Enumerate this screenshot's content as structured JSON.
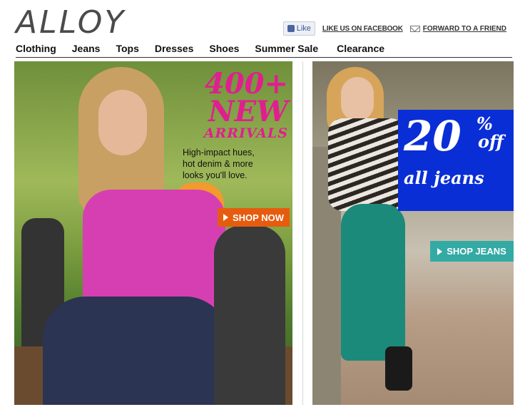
{
  "header": {
    "logo": "ALLOY",
    "social": {
      "like_label": "Like",
      "facebook_label": "LIKE US ON FACEBOOK",
      "forward_label": "FORWARD TO A FRIEND"
    }
  },
  "nav": {
    "items": [
      "Clothing",
      "Jeans",
      "Tops",
      "Dresses",
      "Shoes",
      "Summer Sale",
      "Clearance"
    ]
  },
  "promo_left": {
    "line1": "400+",
    "line2": "NEW",
    "line3": "ARRIVALS",
    "subtext_1": "High-impact hues,",
    "subtext_2": "hot denim & more",
    "subtext_3": "looks you'll love.",
    "cta": "SHOP NOW",
    "accent_color": "#e01f8f",
    "cta_color": "#e65c0f"
  },
  "promo_right": {
    "discount": "20",
    "percent": "%",
    "off": "off",
    "subject": "all jeans",
    "cta": "SHOP JEANS",
    "box_color": "#0a2ed6",
    "cta_color": "#34aaa5"
  }
}
